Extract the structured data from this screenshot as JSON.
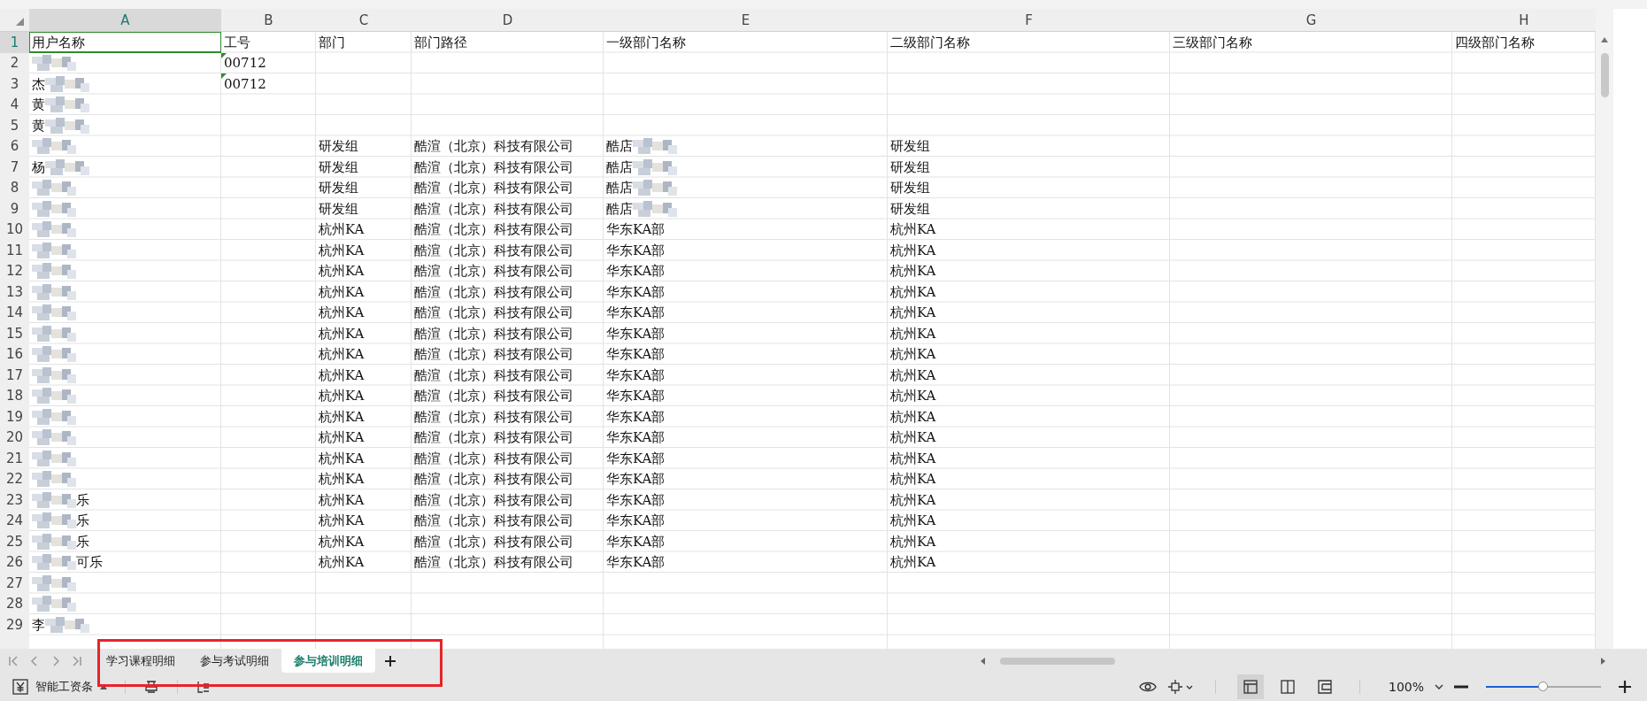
{
  "columns": [
    {
      "letter": "A",
      "selected": true
    },
    {
      "letter": "B",
      "selected": false
    },
    {
      "letter": "C",
      "selected": false
    },
    {
      "letter": "D",
      "selected": false
    },
    {
      "letter": "E",
      "selected": false
    },
    {
      "letter": "F",
      "selected": false
    },
    {
      "letter": "G",
      "selected": false
    },
    {
      "letter": "H",
      "selected": false
    }
  ],
  "rows": [
    {
      "number": "1",
      "selected": true,
      "cells": [
        {
          "text": "用户名称"
        },
        {
          "text": "工号"
        },
        {
          "text": "部门"
        },
        {
          "text": "部门路径"
        },
        {
          "text": "一级部门名称"
        },
        {
          "text": "二级部门名称"
        },
        {
          "text": "三级部门名称"
        },
        {
          "text": "四级部门名称"
        }
      ]
    },
    {
      "number": "2",
      "selected": false,
      "cells": [
        {
          "blur_after": true
        },
        {
          "text": "00712",
          "flagged": true
        }
      ]
    },
    {
      "number": "3",
      "selected": false,
      "cells": [
        {
          "text": "杰",
          "blur_after": true
        },
        {
          "text": "00712",
          "flagged": true
        }
      ]
    },
    {
      "number": "4",
      "selected": false,
      "cells": [
        {
          "text": "黄",
          "blur_after": true
        }
      ]
    },
    {
      "number": "5",
      "selected": false,
      "cells": [
        {
          "text": "黄",
          "blur_after": true
        }
      ]
    },
    {
      "number": "6",
      "selected": false,
      "cells": [
        {
          "blur_after": true
        },
        null,
        {
          "text": "研发组"
        },
        {
          "text": "酷渲（北京）科技有限公司"
        },
        {
          "text": "酷店",
          "blur_after": true
        },
        {
          "text": "研发组"
        }
      ]
    },
    {
      "number": "7",
      "selected": false,
      "cells": [
        {
          "text": "杨",
          "blur_after": true
        },
        null,
        {
          "text": "研发组"
        },
        {
          "text": "酷渲（北京）科技有限公司"
        },
        {
          "text": "酷店",
          "blur_after": true
        },
        {
          "text": "研发组"
        }
      ]
    },
    {
      "number": "8",
      "selected": false,
      "cells": [
        {
          "blur_after": true
        },
        null,
        {
          "text": "研发组"
        },
        {
          "text": "酷渲（北京）科技有限公司"
        },
        {
          "text": "酷店",
          "blur_after": true
        },
        {
          "text": "研发组"
        }
      ]
    },
    {
      "number": "9",
      "selected": false,
      "cells": [
        {
          "blur_after": true
        },
        null,
        {
          "text": "研发组"
        },
        {
          "text": "酷渲（北京）科技有限公司"
        },
        {
          "text": "酷店",
          "blur_after": true
        },
        {
          "text": "研发组"
        }
      ]
    },
    {
      "number": "10",
      "selected": false,
      "cells": [
        {
          "blur_after": true
        },
        null,
        {
          "text": "杭州KA"
        },
        {
          "text": "酷渲（北京）科技有限公司"
        },
        {
          "text": "华东KA部"
        },
        {
          "text": "杭州KA"
        }
      ]
    },
    {
      "number": "11",
      "selected": false,
      "cells": [
        {
          "blur_after": true
        },
        null,
        {
          "text": "杭州KA"
        },
        {
          "text": "酷渲（北京）科技有限公司"
        },
        {
          "text": "华东KA部"
        },
        {
          "text": "杭州KA"
        }
      ]
    },
    {
      "number": "12",
      "selected": false,
      "cells": [
        {
          "blur_after": true
        },
        null,
        {
          "text": "杭州KA"
        },
        {
          "text": "酷渲（北京）科技有限公司"
        },
        {
          "text": "华东KA部"
        },
        {
          "text": "杭州KA"
        }
      ]
    },
    {
      "number": "13",
      "selected": false,
      "cells": [
        {
          "blur_after": true
        },
        null,
        {
          "text": "杭州KA"
        },
        {
          "text": "酷渲（北京）科技有限公司"
        },
        {
          "text": "华东KA部"
        },
        {
          "text": "杭州KA"
        }
      ]
    },
    {
      "number": "14",
      "selected": false,
      "cells": [
        {
          "blur_after": true
        },
        null,
        {
          "text": "杭州KA"
        },
        {
          "text": "酷渲（北京）科技有限公司"
        },
        {
          "text": "华东KA部"
        },
        {
          "text": "杭州KA"
        }
      ]
    },
    {
      "number": "15",
      "selected": false,
      "cells": [
        {
          "blur_after": true
        },
        null,
        {
          "text": "杭州KA"
        },
        {
          "text": "酷渲（北京）科技有限公司"
        },
        {
          "text": "华东KA部"
        },
        {
          "text": "杭州KA"
        }
      ]
    },
    {
      "number": "16",
      "selected": false,
      "cells": [
        {
          "blur_after": true
        },
        null,
        {
          "text": "杭州KA"
        },
        {
          "text": "酷渲（北京）科技有限公司"
        },
        {
          "text": "华东KA部"
        },
        {
          "text": "杭州KA"
        }
      ]
    },
    {
      "number": "17",
      "selected": false,
      "cells": [
        {
          "blur_after": true
        },
        null,
        {
          "text": "杭州KA"
        },
        {
          "text": "酷渲（北京）科技有限公司"
        },
        {
          "text": "华东KA部"
        },
        {
          "text": "杭州KA"
        }
      ]
    },
    {
      "number": "18",
      "selected": false,
      "cells": [
        {
          "blur_after": true
        },
        null,
        {
          "text": "杭州KA"
        },
        {
          "text": "酷渲（北京）科技有限公司"
        },
        {
          "text": "华东KA部"
        },
        {
          "text": "杭州KA"
        }
      ]
    },
    {
      "number": "19",
      "selected": false,
      "cells": [
        {
          "blur_after": true
        },
        null,
        {
          "text": "杭州KA"
        },
        {
          "text": "酷渲（北京）科技有限公司"
        },
        {
          "text": "华东KA部"
        },
        {
          "text": "杭州KA"
        }
      ]
    },
    {
      "number": "20",
      "selected": false,
      "cells": [
        {
          "blur_after": true
        },
        null,
        {
          "text": "杭州KA"
        },
        {
          "text": "酷渲（北京）科技有限公司"
        },
        {
          "text": "华东KA部"
        },
        {
          "text": "杭州KA"
        }
      ]
    },
    {
      "number": "21",
      "selected": false,
      "cells": [
        {
          "blur_after": true
        },
        null,
        {
          "text": "杭州KA"
        },
        {
          "text": "酷渲（北京）科技有限公司"
        },
        {
          "text": "华东KA部"
        },
        {
          "text": "杭州KA"
        }
      ]
    },
    {
      "number": "22",
      "selected": false,
      "cells": [
        {
          "blur_after": true
        },
        null,
        {
          "text": "杭州KA"
        },
        {
          "text": "酷渲（北京）科技有限公司"
        },
        {
          "text": "华东KA部"
        },
        {
          "text": "杭州KA"
        }
      ]
    },
    {
      "number": "23",
      "selected": false,
      "cells": [
        {
          "text": "乐",
          "blur_before": true
        },
        null,
        {
          "text": "杭州KA"
        },
        {
          "text": "酷渲（北京）科技有限公司"
        },
        {
          "text": "华东KA部"
        },
        {
          "text": "杭州KA"
        }
      ]
    },
    {
      "number": "24",
      "selected": false,
      "cells": [
        {
          "text": "乐",
          "blur_before": true
        },
        null,
        {
          "text": "杭州KA"
        },
        {
          "text": "酷渲（北京）科技有限公司"
        },
        {
          "text": "华东KA部"
        },
        {
          "text": "杭州KA"
        }
      ]
    },
    {
      "number": "25",
      "selected": false,
      "cells": [
        {
          "text": "乐",
          "blur_before": true
        },
        null,
        {
          "text": "杭州KA"
        },
        {
          "text": "酷渲（北京）科技有限公司"
        },
        {
          "text": "华东KA部"
        },
        {
          "text": "杭州KA"
        }
      ]
    },
    {
      "number": "26",
      "selected": false,
      "cells": [
        {
          "text": "可乐",
          "blur_before": true
        },
        null,
        {
          "text": "杭州KA"
        },
        {
          "text": "酷渲（北京）科技有限公司"
        },
        {
          "text": "华东KA部"
        },
        {
          "text": "杭州KA"
        }
      ]
    },
    {
      "number": "27",
      "selected": false,
      "cells": [
        {
          "blur_after": true
        }
      ]
    },
    {
      "number": "28",
      "selected": false,
      "cells": [
        {
          "blur_after": true
        }
      ]
    },
    {
      "number": "29",
      "selected": false,
      "cells": [
        {
          "text": "李",
          "blur_after": true
        }
      ]
    }
  ],
  "sheet_tabs": [
    {
      "label": "学习课程明细",
      "selected": false
    },
    {
      "label": "参与考试明细",
      "selected": false
    },
    {
      "label": "参与培训明细",
      "selected": true
    }
  ],
  "status_bar": {
    "app_label": "智能工资条",
    "view_buttons": [
      {
        "kind": "normal",
        "selected": true
      },
      {
        "kind": "split",
        "selected": false
      },
      {
        "kind": "page",
        "selected": false
      }
    ],
    "zoom": "100%",
    "zoom_slider": {
      "level": 0.5
    }
  }
}
